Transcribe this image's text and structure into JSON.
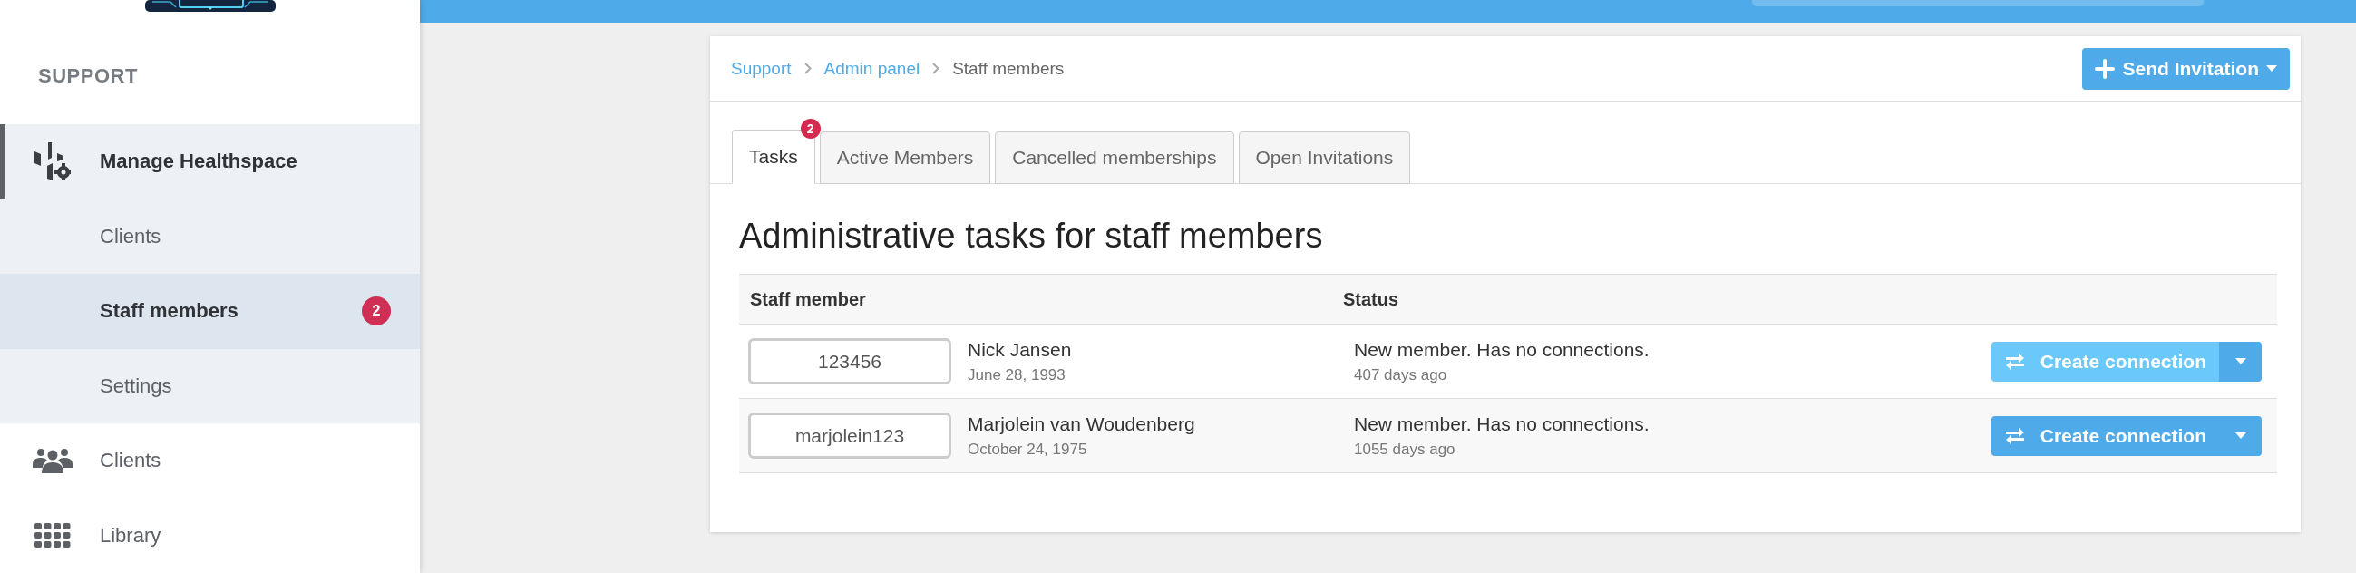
{
  "sidebar": {
    "section": "SUPPORT",
    "items": [
      {
        "label": "Manage Healthspace",
        "expanded": true,
        "selected": false,
        "children": [
          {
            "label": "Clients",
            "selected": false
          },
          {
            "label": "Staff members",
            "selected": true,
            "badge": "2"
          },
          {
            "label": "Settings",
            "selected": false
          }
        ]
      },
      {
        "label": "Clients",
        "selected": false
      },
      {
        "label": "Library",
        "selected": false
      }
    ]
  },
  "breadcrumb": [
    {
      "label": "Support",
      "link": true
    },
    {
      "label": "Admin panel",
      "link": true
    },
    {
      "label": "Staff members",
      "link": false
    }
  ],
  "send_button": {
    "label": "Send Invitation"
  },
  "tabs": [
    {
      "label": "Tasks",
      "selected": true,
      "badge": "2"
    },
    {
      "label": "Active Members",
      "selected": false
    },
    {
      "label": "Cancelled memberships",
      "selected": false
    },
    {
      "label": "Open Invitations",
      "selected": false
    }
  ],
  "heading": "Administrative tasks for staff members",
  "table": {
    "columns": [
      "Staff member",
      "Status"
    ],
    "rows": [
      {
        "id": "123456",
        "name": "Nick Jansen",
        "birth_date": "June 28, 1993",
        "status": "New member. Has no connections.",
        "age": "407 days ago",
        "action": "Create connection",
        "hovered": true
      },
      {
        "id": "marjolein123",
        "name": "Marjolein van Woudenberg",
        "birth_date": "October 24, 1975",
        "status": "New member. Has no connections.",
        "age": "1055 days ago",
        "action": "Create connection",
        "hovered": false
      }
    ]
  }
}
